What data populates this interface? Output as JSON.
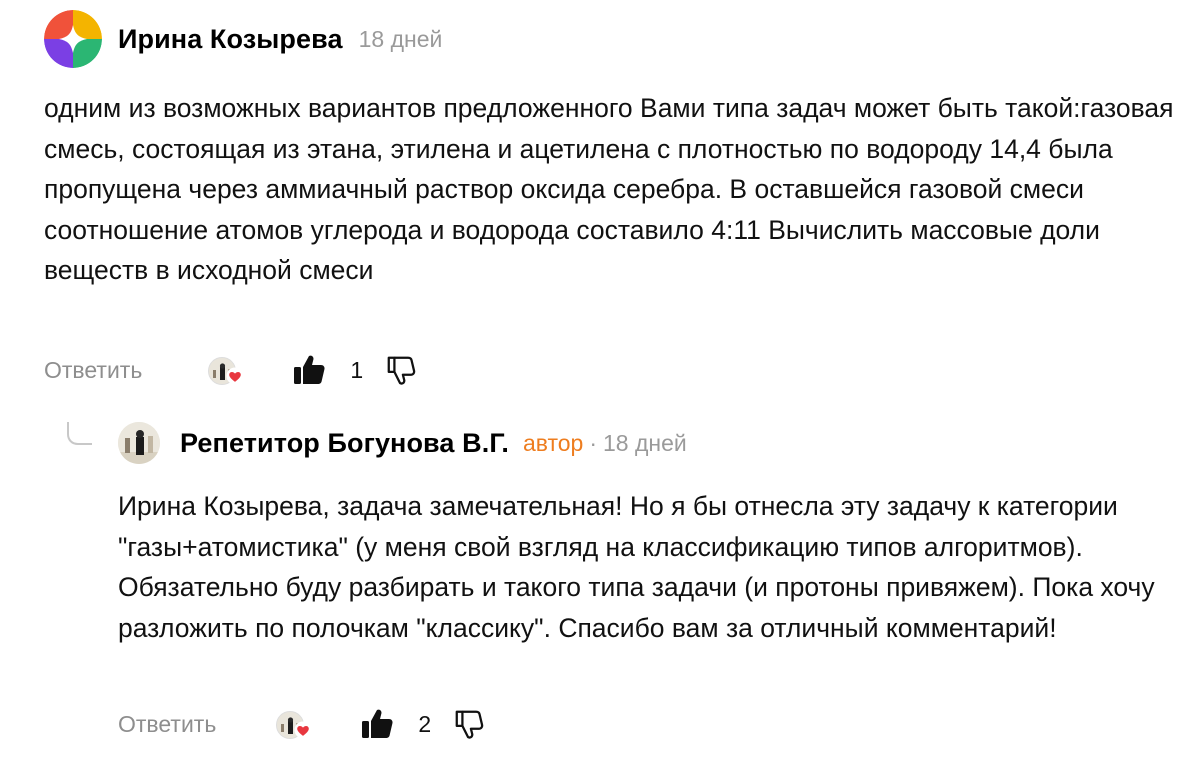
{
  "comments": [
    {
      "author": "Ирина Козырева",
      "age": "18 дней",
      "text": "одним из возможных вариантов предложенного Вами типа задач может быть такой:газовая смесь, состоящая из этана, этилена и ацетилена с плотностью по водороду 14,4 была пропущена через аммиачный раствор оксида серебра. В оставшейся газовой смеси соотношение атомов углерода и водорода составило 4:11 Вычислить массовые доли веществ в исходной смеси",
      "reply_label": "Ответить",
      "likes": "1",
      "avatar_icon": "multicolor-logo-avatar"
    },
    {
      "author": "Репетитор Богунова В.Г.",
      "badge": "автор",
      "separator": "·",
      "age": "18 дней",
      "text": "Ирина Козырева, задача замечательная! Но я бы отнесла эту задачу к категории \"газы+атомистика\" (у меня свой взгляд на классификацию типов алгоритмов). Обязательно буду разбирать и такого типа задачи (и протоны привяжем). Пока хочу разложить по полочкам \"классику\". Спасибо вам за отличный комментарий!",
      "reply_label": "Ответить",
      "likes": "2",
      "avatar_icon": "photo-avatar"
    }
  ],
  "colors": {
    "author_badge": "#ee7d1f",
    "muted": "#9a9a9a",
    "heart": "#e8373f"
  }
}
